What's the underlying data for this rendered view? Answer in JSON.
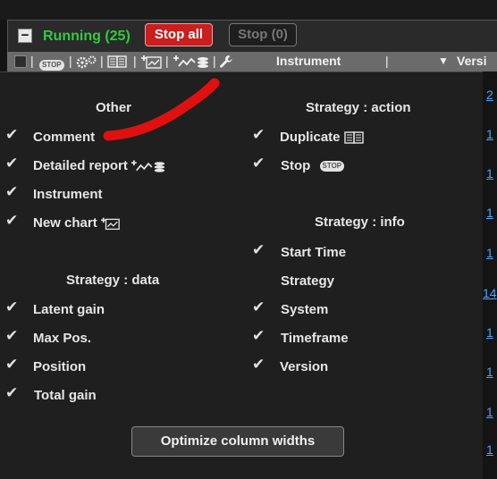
{
  "toolbar": {
    "running_label": "Running (25)",
    "stop_all_label": "Stop all",
    "stop_label": "Stop (0)",
    "collapse_glyph": "−"
  },
  "columns": {
    "stop_badge": "STOP",
    "instrument": "Instrument",
    "version": "Versi",
    "separator": "|",
    "sort_glyph": "▼"
  },
  "right_links": [
    "2",
    "1",
    "1",
    "1",
    "1",
    "14",
    "1",
    "1",
    "1",
    "1"
  ],
  "menu": {
    "other_title": "Other",
    "strategy_action_title": "Strategy : action",
    "strategy_info_title": "Strategy : info",
    "strategy_data_title": "Strategy : data",
    "check_glyph": "✔",
    "other_items": [
      "Comment",
      "Detailed report",
      "Instrument",
      "New chart"
    ],
    "data_items": [
      "Latent gain",
      "Max Pos.",
      "Position",
      "Total gain"
    ],
    "action_items": [
      "Duplicate",
      "Stop"
    ],
    "action_stop_badge": "STOP",
    "info_items": [
      "Start Time",
      "Strategy",
      "System",
      "Timeframe",
      "Version"
    ],
    "optimize_label": "Optimize column widths"
  },
  "colors": {
    "running_green": "#2ecc40",
    "stop_all_red": "#c91f1f",
    "annotation_red": "#e01010",
    "link_blue": "#4da6ff"
  }
}
